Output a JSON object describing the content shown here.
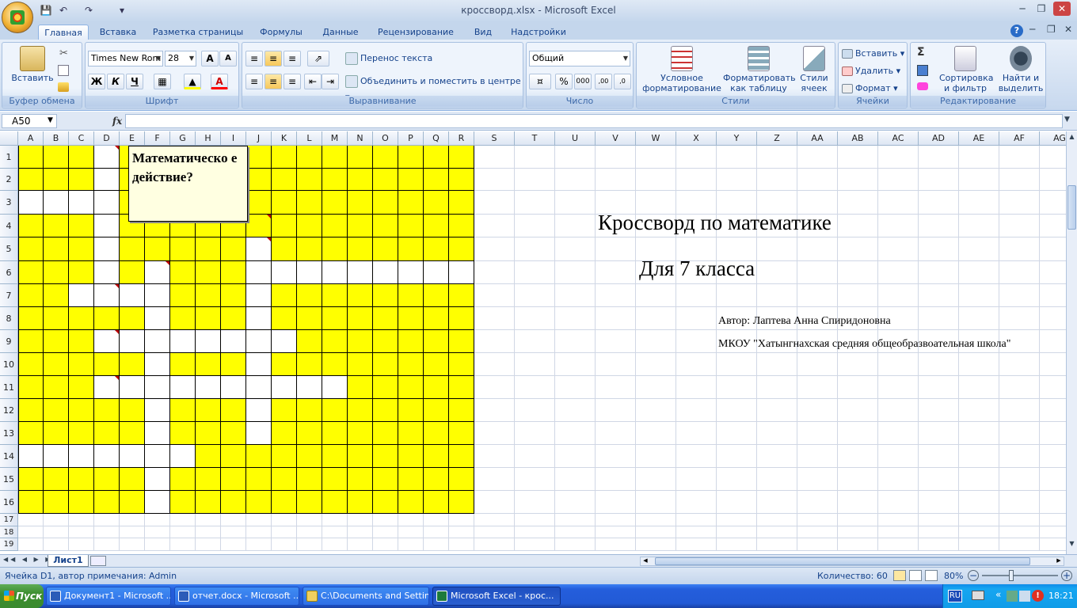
{
  "window": {
    "title": "кроссворд.xlsx - Microsoft Excel"
  },
  "tabs": [
    "Главная",
    "Вставка",
    "Разметка страницы",
    "Формулы",
    "Данные",
    "Рецензирование",
    "Вид",
    "Надстройки"
  ],
  "ribbon": {
    "clipboard": {
      "label": "Буфер обмена",
      "paste": "Вставить"
    },
    "font": {
      "label": "Шрифт",
      "font_name": "Times New Rom",
      "font_size": "28",
      "bold": "Ж",
      "italic": "К",
      "underline": "Ч"
    },
    "alignment": {
      "label": "Выравнивание",
      "wrap": "Перенос текста",
      "merge": "Объединить и поместить в центре"
    },
    "number": {
      "label": "Число",
      "format": "Общий"
    },
    "styles": {
      "label": "Стили",
      "conditional": "Условное форматирование",
      "as_table": "Форматировать как таблицу",
      "cell_styles": "Стили ячеек"
    },
    "cells": {
      "label": "Ячейки",
      "insert": "Вставить",
      "delete": "Удалить",
      "format": "Формат"
    },
    "editing": {
      "label": "Редактирование",
      "sort": "Сортировка и фильтр",
      "find": "Найти и выделить"
    }
  },
  "formula_bar": {
    "name_box": "A50",
    "fx": "fx",
    "value": ""
  },
  "columns": [
    "A",
    "B",
    "C",
    "D",
    "E",
    "F",
    "G",
    "H",
    "I",
    "J",
    "K",
    "L",
    "M",
    "N",
    "O",
    "P",
    "Q",
    "R",
    "S",
    "T",
    "U",
    "V",
    "W",
    "X",
    "Y",
    "Z",
    "AA",
    "AB",
    "AC",
    "AD",
    "AE",
    "AF",
    "AG"
  ],
  "rows": [
    "1",
    "2",
    "3",
    "4",
    "5",
    "6",
    "7",
    "8",
    "9",
    "10",
    "11",
    "12",
    "13",
    "14",
    "15",
    "16",
    "17",
    "18",
    "19"
  ],
  "comment": {
    "text": "Математическо е действие?"
  },
  "sheet_text": {
    "title": "Кроссворд по математике",
    "subtitle": "Для 7 класса",
    "author": "Автор: Лаптева Анна Спиридоновна",
    "school": "МКОУ \"Хатынгнахская средняя общеобразвоательная школа\""
  },
  "sheet_tabs": {
    "active": "Лист1"
  },
  "status": {
    "left": "Ячейка D1, автор примечания: Admin",
    "count": "Количество: 60",
    "zoom": "80%"
  },
  "taskbar": {
    "start": "Пуск",
    "items": [
      "Документ1 - Microsoft ...",
      "отчет.docx - Microsoft ...",
      "C:\\Documents and Settin...",
      "Microsoft Excel - крос..."
    ],
    "lang": "RU",
    "clock": "18:21"
  },
  "crossword": {
    "white_cells": [
      [
        0,
        3
      ],
      [
        1,
        3
      ],
      [
        2,
        0
      ],
      [
        2,
        1
      ],
      [
        2,
        2
      ],
      [
        2,
        3
      ],
      [
        3,
        3
      ],
      [
        4,
        3
      ],
      [
        4,
        9
      ],
      [
        5,
        3
      ],
      [
        5,
        5
      ],
      [
        5,
        9
      ],
      [
        5,
        10
      ],
      [
        5,
        11
      ],
      [
        5,
        12
      ],
      [
        5,
        13
      ],
      [
        5,
        14
      ],
      [
        5,
        15
      ],
      [
        5,
        16
      ],
      [
        5,
        17
      ],
      [
        6,
        2
      ],
      [
        6,
        3
      ],
      [
        6,
        4
      ],
      [
        6,
        5
      ],
      [
        6,
        9
      ],
      [
        7,
        5
      ],
      [
        7,
        9
      ],
      [
        8,
        3
      ],
      [
        8,
        4
      ],
      [
        8,
        5
      ],
      [
        8,
        6
      ],
      [
        8,
        7
      ],
      [
        8,
        8
      ],
      [
        8,
        9
      ],
      [
        8,
        10
      ],
      [
        9,
        5
      ],
      [
        9,
        9
      ],
      [
        10,
        3
      ],
      [
        10,
        4
      ],
      [
        10,
        5
      ],
      [
        10,
        6
      ],
      [
        10,
        7
      ],
      [
        10,
        8
      ],
      [
        10,
        9
      ],
      [
        10,
        10
      ],
      [
        10,
        11
      ],
      [
        10,
        12
      ],
      [
        11,
        5
      ],
      [
        11,
        9
      ],
      [
        12,
        5
      ],
      [
        12,
        9
      ],
      [
        13,
        0
      ],
      [
        13,
        1
      ],
      [
        13,
        2
      ],
      [
        13,
        3
      ],
      [
        13,
        4
      ],
      [
        13,
        5
      ],
      [
        13,
        6
      ],
      [
        14,
        5
      ],
      [
        15,
        5
      ]
    ],
    "comment_marks": [
      [
        0,
        3
      ],
      [
        3,
        9
      ],
      [
        4,
        9
      ],
      [
        5,
        5
      ],
      [
        6,
        3
      ],
      [
        8,
        3
      ],
      [
        10,
        3
      ]
    ]
  }
}
